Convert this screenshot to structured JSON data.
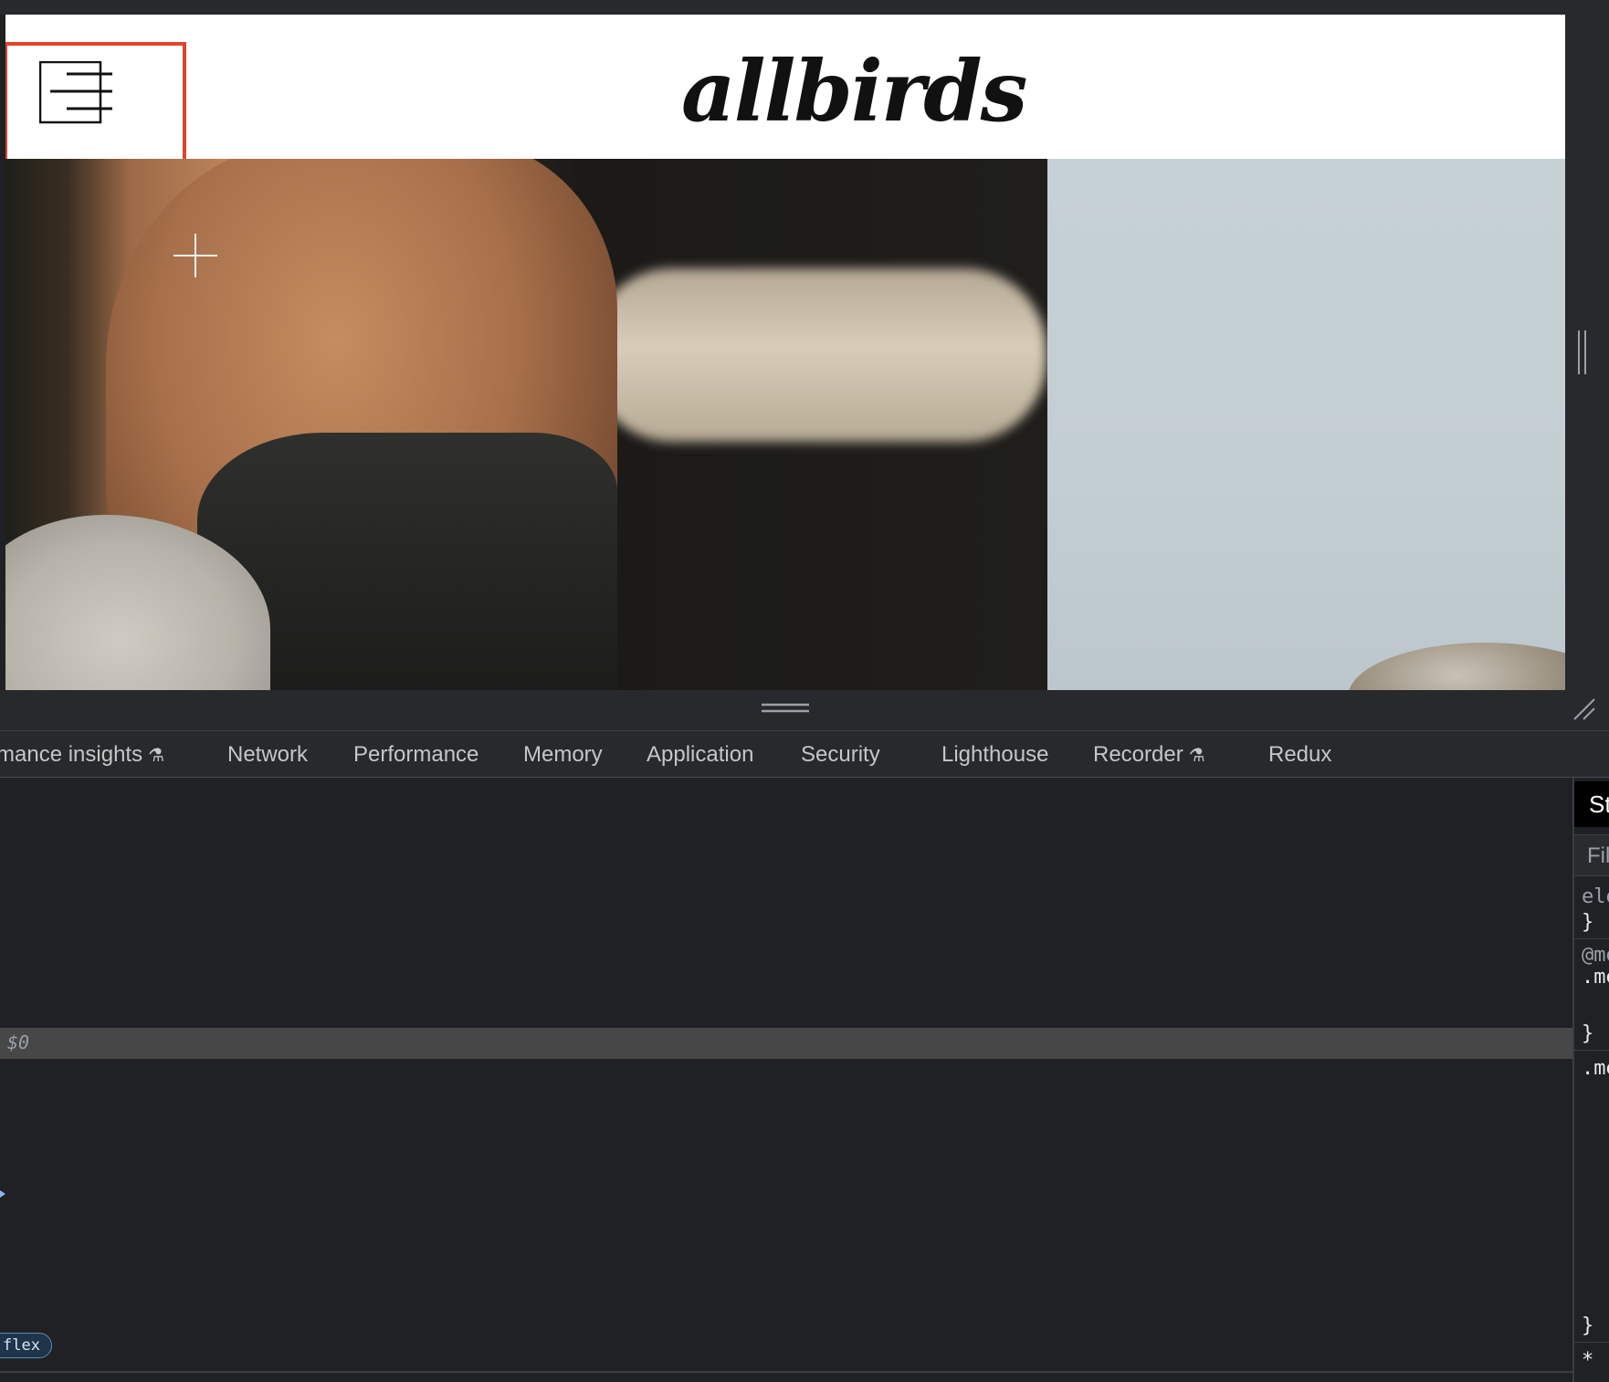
{
  "site": {
    "logo_text": "allbirds",
    "menu_icon": "hamburger-menu-icon",
    "highlight_color": "#e0442e"
  },
  "devtools": {
    "tabs": [
      {
        "label": "mance insights",
        "experimental": true
      },
      {
        "label": "Network",
        "experimental": false
      },
      {
        "label": "Performance",
        "experimental": false
      },
      {
        "label": "Memory",
        "experimental": false
      },
      {
        "label": "Application",
        "experimental": false
      },
      {
        "label": "Security",
        "experimental": false
      },
      {
        "label": "Lighthouse",
        "experimental": false
      },
      {
        "label": "Recorder",
        "experimental": true
      },
      {
        "label": "Redux",
        "experimental": false
      }
    ],
    "elements": {
      "selected_marker": "$0",
      "badge": "flex"
    },
    "styles": {
      "tab_label": "St",
      "filter_placeholder": "Fil",
      "lines": [
        "ele",
        "}",
        "@me",
        ".me",
        "}",
        ".me",
        "}",
        "* "
      ]
    }
  }
}
